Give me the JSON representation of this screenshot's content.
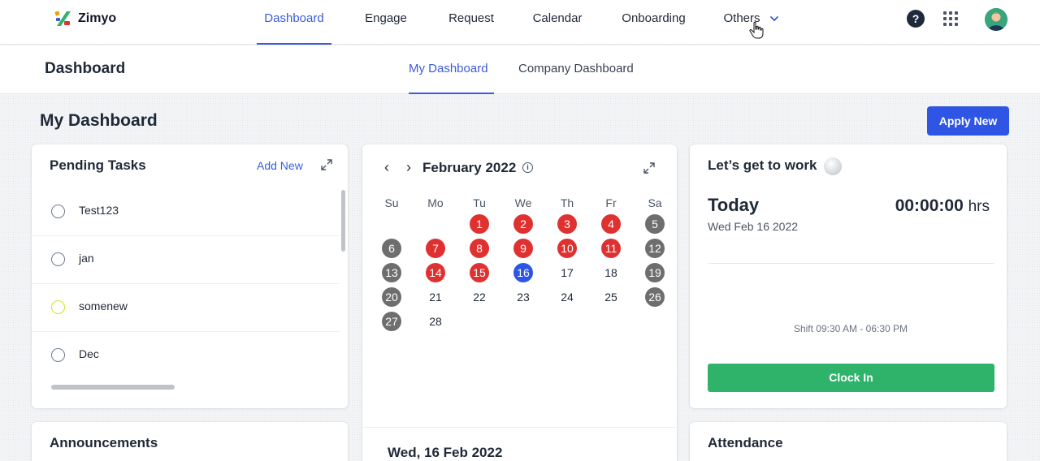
{
  "app": {
    "name": "Zimyo",
    "colors": {
      "accent": "#2f55e4",
      "active_link": "#3b5bdb",
      "holiday_red": "#e03131",
      "weekend_grey": "#6e6e6e",
      "clock_in_green": "#2fb36b"
    }
  },
  "nav": {
    "items": [
      {
        "label": "Dashboard",
        "active": true
      },
      {
        "label": "Engage"
      },
      {
        "label": "Request"
      },
      {
        "label": "Calendar"
      },
      {
        "label": "Onboarding"
      },
      {
        "label": "Others",
        "icon": "chevron-down-icon"
      }
    ],
    "help_label": "?",
    "icons": [
      "help-icon",
      "apps-grid-icon",
      "avatar"
    ]
  },
  "subheader": {
    "title": "Dashboard",
    "tabs": [
      {
        "label": "My Dashboard",
        "active": true
      },
      {
        "label": "Company Dashboard"
      }
    ]
  },
  "page": {
    "title": "My Dashboard",
    "apply_button": "Apply New"
  },
  "pending_tasks": {
    "title": "Pending Tasks",
    "add_new": "Add New",
    "tasks": [
      {
        "label": "Test123",
        "color": "#6b7d8f"
      },
      {
        "label": "jan",
        "color": "#6b7d8f"
      },
      {
        "label": "somenew",
        "color": "#d4e02b"
      },
      {
        "label": "Dec",
        "color": "#6b7d8f"
      }
    ]
  },
  "calendar": {
    "prev": "‹",
    "next": "›",
    "month": "February 2022",
    "info": "i",
    "weekdays": [
      "Su",
      "Mo",
      "Tu",
      "We",
      "Th",
      "Fr",
      "Sa"
    ],
    "days": [
      {
        "d": "1",
        "s": "red"
      },
      {
        "d": "2",
        "s": "red"
      },
      {
        "d": "3",
        "s": "red"
      },
      {
        "d": "4",
        "s": "red"
      },
      {
        "d": "5",
        "s": "grey"
      },
      {
        "d": "6",
        "s": "grey"
      },
      {
        "d": "7",
        "s": "red"
      },
      {
        "d": "8",
        "s": "red"
      },
      {
        "d": "9",
        "s": "red"
      },
      {
        "d": "10",
        "s": "red"
      },
      {
        "d": "11",
        "s": "red"
      },
      {
        "d": "12",
        "s": "grey"
      },
      {
        "d": "13",
        "s": "grey"
      },
      {
        "d": "14",
        "s": "red"
      },
      {
        "d": "15",
        "s": "red"
      },
      {
        "d": "16",
        "s": "blue"
      },
      {
        "d": "17",
        "s": ""
      },
      {
        "d": "18",
        "s": ""
      },
      {
        "d": "19",
        "s": "grey"
      },
      {
        "d": "20",
        "s": "grey"
      },
      {
        "d": "21",
        "s": ""
      },
      {
        "d": "22",
        "s": ""
      },
      {
        "d": "23",
        "s": ""
      },
      {
        "d": "24",
        "s": ""
      },
      {
        "d": "25",
        "s": ""
      },
      {
        "d": "26",
        "s": "grey"
      },
      {
        "d": "27",
        "s": "grey"
      },
      {
        "d": "28",
        "s": ""
      }
    ],
    "selected_date": "Wed, 16 Feb 2022"
  },
  "work": {
    "title": "Let’s get to work",
    "today_label": "Today",
    "today_date": "Wed Feb 16 2022",
    "timer": "00:00:00",
    "timer_unit": "hrs",
    "shift": "Shift 09:30 AM - 06:30 PM",
    "clock_in": "Clock In"
  },
  "bottom_cards": {
    "announcements": "Announcements",
    "attendance": "Attendance"
  }
}
